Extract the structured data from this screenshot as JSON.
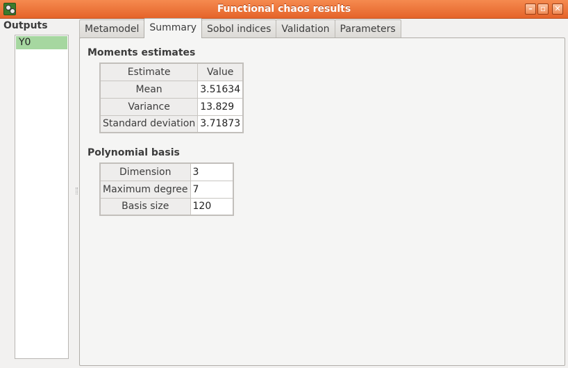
{
  "window": {
    "title": "Functional chaos results",
    "controls": {
      "minimize": "–",
      "maximize": "▫",
      "close": "✕"
    }
  },
  "sidebar": {
    "label": "Outputs",
    "items": [
      {
        "label": "Y0",
        "selected": true
      }
    ]
  },
  "tabs": [
    {
      "label": "Metamodel",
      "active": false
    },
    {
      "label": "Summary",
      "active": true
    },
    {
      "label": "Sobol indices",
      "active": false
    },
    {
      "label": "Validation",
      "active": false
    },
    {
      "label": "Parameters",
      "active": false
    }
  ],
  "moments": {
    "title": "Moments estimates",
    "headers": [
      "Estimate",
      "Value"
    ],
    "rows": [
      {
        "name": "Mean",
        "value": "3.51634"
      },
      {
        "name": "Variance",
        "value": "13.829"
      },
      {
        "name": "Standard deviation",
        "value": "3.71873"
      }
    ]
  },
  "basis": {
    "title": "Polynomial basis",
    "rows": [
      {
        "name": "Dimension",
        "value": "3"
      },
      {
        "name": "Maximum degree",
        "value": "7"
      },
      {
        "name": "Basis size",
        "value": "120"
      }
    ]
  },
  "colors": {
    "titlebar": "#e5642a",
    "selection": "#a6d7a0"
  }
}
